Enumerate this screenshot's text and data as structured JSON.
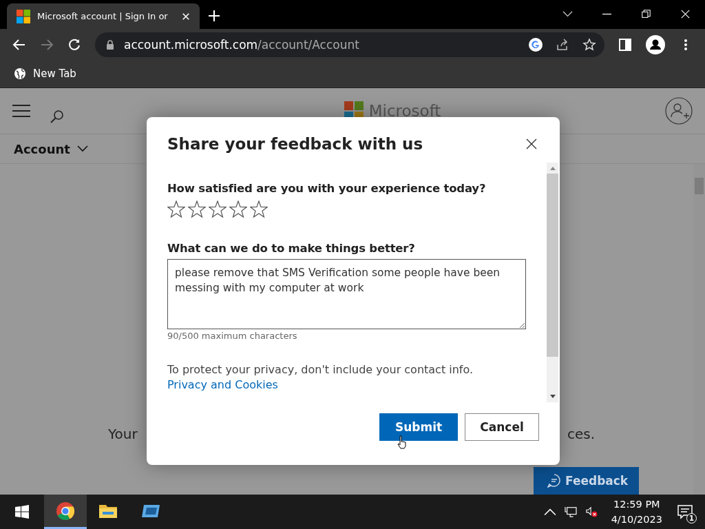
{
  "browser": {
    "tabs": [
      {
        "title": "Microsoft account | Sign In or",
        "selected": true
      }
    ],
    "url_host": "account.microsoft.com",
    "url_path": "/account/Account",
    "bookmarks": [
      {
        "label": "New Tab"
      }
    ]
  },
  "page": {
    "brand": "Microsoft",
    "nav_label": "Account",
    "body_left": "Your",
    "body_right": "ces.",
    "feedback_button": "Feedback"
  },
  "dialog": {
    "title": "Share your feedback with us",
    "rating_question": "How satisfied are you with your experience today?",
    "stars": 0,
    "improve_question": "What can we do to make things better?",
    "feedback_value": "please remove that SMS Verification some people have been messing with my computer at work",
    "counter": "90/500 maximum characters",
    "privacy_note": "To protect your privacy, don't include your contact info.",
    "privacy_link": "Privacy and Cookies",
    "buttons": [
      {
        "label": "Submit",
        "kind": "primary"
      },
      {
        "label": "Cancel",
        "kind": "secondary"
      }
    ]
  },
  "taskbar": {
    "apps": [
      {
        "kind": "chrome",
        "selected": true
      },
      {
        "kind": "folder",
        "selected": false
      },
      {
        "kind": "window",
        "selected": false
      }
    ],
    "time": "12:59 PM",
    "date": "4/10/2023",
    "notifications": "1"
  }
}
